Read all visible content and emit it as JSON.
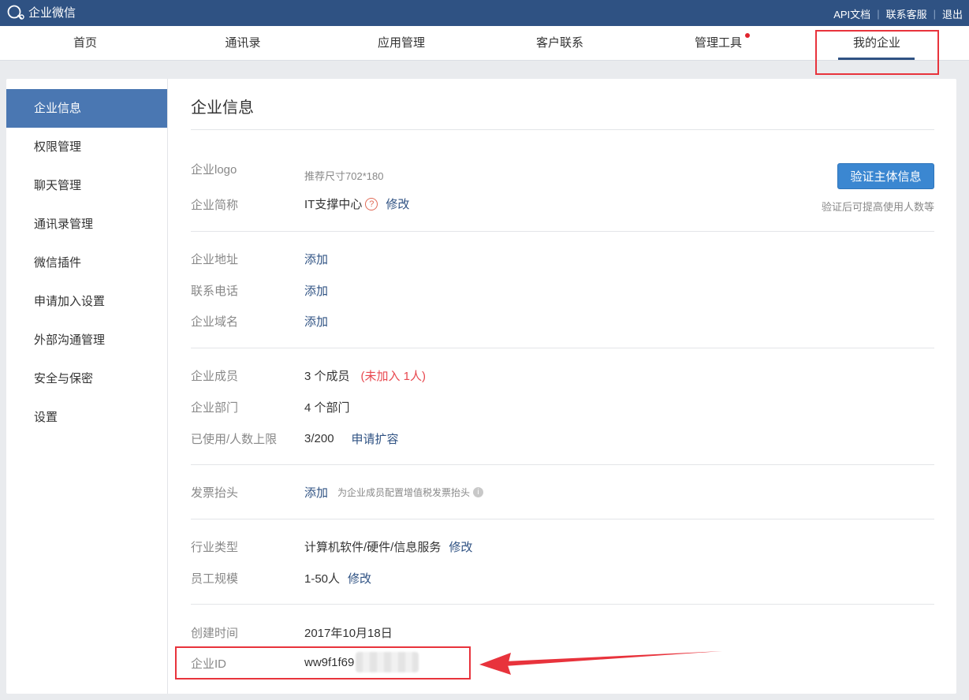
{
  "topbar": {
    "brand": "企业微信",
    "links": [
      "API文档",
      "联系客服",
      "退出"
    ]
  },
  "nav": {
    "items": [
      "首页",
      "通讯录",
      "应用管理",
      "客户联系",
      "管理工具",
      "我的企业"
    ],
    "active": "我的企业"
  },
  "sidebar": {
    "items": [
      "企业信息",
      "权限管理",
      "聊天管理",
      "通讯录管理",
      "微信插件",
      "申请加入设置",
      "外部沟通管理",
      "安全与保密",
      "设置"
    ],
    "active": "企业信息"
  },
  "main": {
    "title": "企业信息",
    "logo": {
      "label": "企业logo",
      "hint": "推荐尺寸702*180"
    },
    "short_name": {
      "label": "企业简称",
      "value": "IT支撑中心",
      "help": "?",
      "edit": "修改"
    },
    "verify": {
      "button": "验证主体信息",
      "note": "验证后可提高使用人数等"
    },
    "address": {
      "label": "企业地址",
      "action": "添加"
    },
    "phone": {
      "label": "联系电话",
      "action": "添加"
    },
    "domain": {
      "label": "企业域名",
      "action": "添加"
    },
    "members": {
      "label": "企业成员",
      "value": "3 个成员",
      "extra": "(未加入 1人)"
    },
    "departments": {
      "label": "企业部门",
      "value": "4 个部门"
    },
    "limit": {
      "label": "已使用/人数上限",
      "value": "3/200",
      "action": "申请扩容"
    },
    "invoice": {
      "label": "发票抬头",
      "action": "添加",
      "hint": "为企业成员配置增值税发票抬头",
      "info": "i"
    },
    "industry": {
      "label": "行业类型",
      "value": "计算机软件/硬件/信息服务",
      "edit": "修改"
    },
    "scale": {
      "label": "员工规模",
      "value": "1-50人",
      "edit": "修改"
    },
    "created": {
      "label": "创建时间",
      "value": "2017年10月18日"
    },
    "corp_id": {
      "label": "企业ID",
      "value": "ww9f1f69"
    }
  },
  "colors": {
    "topbar": "#2f5283",
    "accent": "#3b87d1",
    "link": "#2f5283",
    "highlight": "#e8333c"
  }
}
